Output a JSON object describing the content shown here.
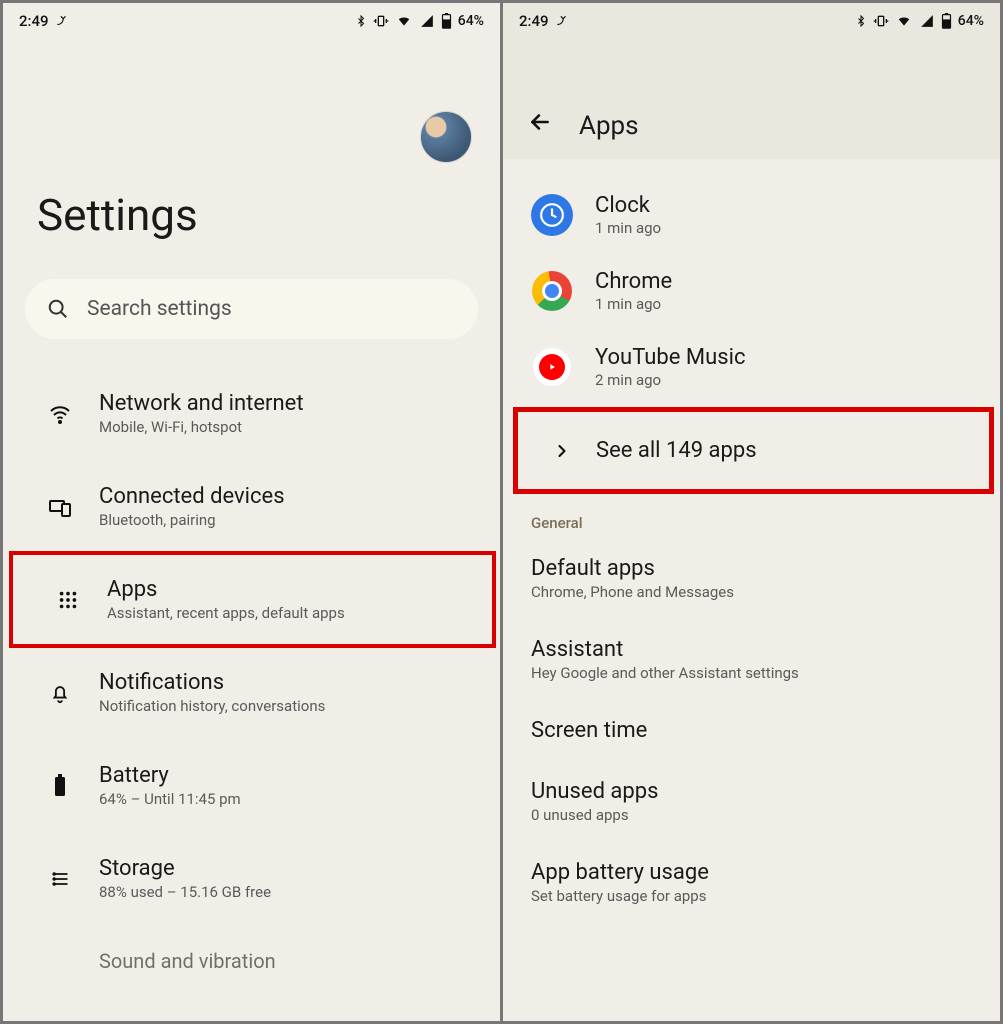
{
  "status": {
    "time": "2:49",
    "battery": "64%"
  },
  "screen1": {
    "title": "Settings",
    "search_placeholder": "Search settings",
    "items": [
      {
        "title": "Network and internet",
        "sub": "Mobile, Wi-Fi, hotspot"
      },
      {
        "title": "Connected devices",
        "sub": "Bluetooth, pairing"
      },
      {
        "title": "Apps",
        "sub": "Assistant, recent apps, default apps"
      },
      {
        "title": "Notifications",
        "sub": "Notification history, conversations"
      },
      {
        "title": "Battery",
        "sub": "64% – Until 11:45 pm"
      },
      {
        "title": "Storage",
        "sub": "88% used – 15.16 GB free"
      },
      {
        "title": "Sound and vibration",
        "sub": ""
      }
    ]
  },
  "screen2": {
    "page_title": "Apps",
    "recent": [
      {
        "title": "Clock",
        "sub": "1 min ago"
      },
      {
        "title": "Chrome",
        "sub": "1 min ago"
      },
      {
        "title": "YouTube Music",
        "sub": "2 min ago"
      }
    ],
    "see_all": "See all 149 apps",
    "section_label": "General",
    "rows": [
      {
        "title": "Default apps",
        "sub": "Chrome, Phone and Messages"
      },
      {
        "title": "Assistant",
        "sub": "Hey Google and other Assistant settings"
      },
      {
        "title": "Screen time",
        "sub": ""
      },
      {
        "title": "Unused apps",
        "sub": "0 unused apps"
      },
      {
        "title": "App battery usage",
        "sub": "Set battery usage for apps"
      }
    ]
  }
}
